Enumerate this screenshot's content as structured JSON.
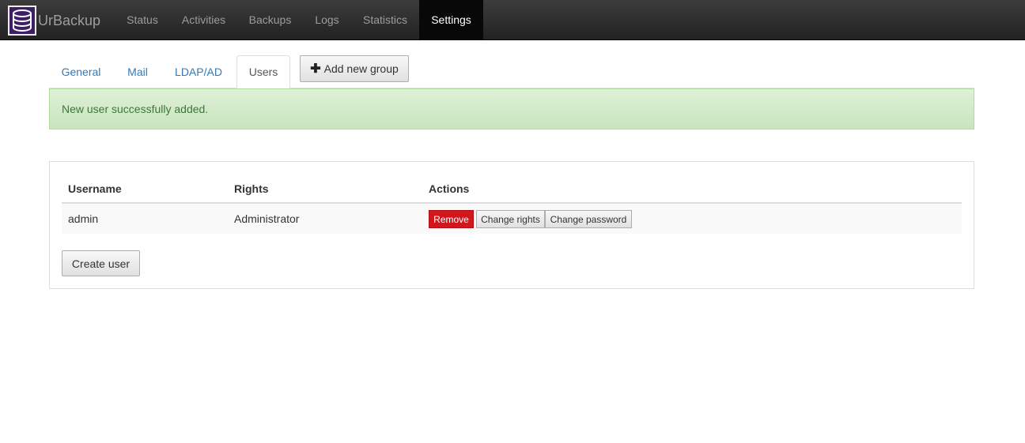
{
  "app": {
    "brand": "UrBackup"
  },
  "nav": {
    "items": [
      {
        "label": "Status"
      },
      {
        "label": "Activities"
      },
      {
        "label": "Backups"
      },
      {
        "label": "Logs"
      },
      {
        "label": "Statistics"
      },
      {
        "label": "Settings",
        "active": true
      }
    ]
  },
  "tabs": {
    "items": [
      {
        "label": "General"
      },
      {
        "label": "Mail"
      },
      {
        "label": "LDAP/AD"
      },
      {
        "label": "Users",
        "active": true
      }
    ],
    "add_group_label": "Add new group"
  },
  "alert": {
    "message": "New user successfully added."
  },
  "users_table": {
    "headers": [
      "Username",
      "Rights",
      "Actions"
    ],
    "rows": [
      {
        "username": "admin",
        "rights": "Administrator",
        "actions": [
          "Remove",
          "Change rights",
          "Change password"
        ]
      }
    ],
    "create_label": "Create user"
  },
  "colors": {
    "navbar": "#222222",
    "link": "#337ab7",
    "alert_bg": "#dff0d8",
    "alert_text": "#3c763d",
    "danger": "#d2171c"
  },
  "icons": {
    "logo": "database-icon",
    "add": "plus-icon"
  }
}
